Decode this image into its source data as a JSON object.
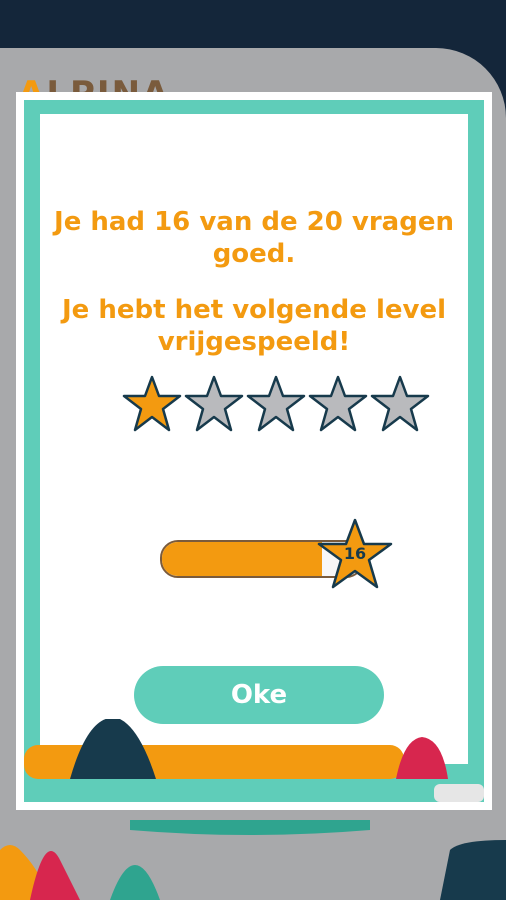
{
  "background": {
    "logo_text": "ALPINA",
    "logo_accent": "A"
  },
  "dialog": {
    "message": {
      "line1": "Je had 16 van de 20 vragen",
      "line2": "goed.",
      "line3": "Je hebt het volgende level",
      "line4": "vrijgespeeld!"
    },
    "rating": {
      "filled": 1,
      "total": 5
    },
    "progress": {
      "score": "16",
      "fraction": 0.8
    },
    "ok_button": "Oke"
  },
  "colors": {
    "accent": "#f39a10",
    "teal": "#5fcdb9",
    "navy": "#173a4c",
    "star_empty": "#b9babd",
    "star_outline": "#173a4c"
  }
}
